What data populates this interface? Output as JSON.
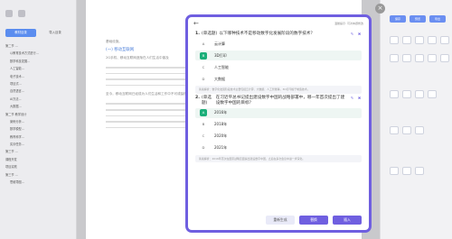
{
  "sidebar": {
    "tabs": [
      "教材目录",
      "导入目录"
    ],
    "items": [
      "第二节 ...",
      "以教育技术方式进行...",
      "数学科技发展...",
      "人工智能...",
      "电子技术...",
      "项目式...",
      "自然语言...",
      "AI方法...",
      "大数据...",
      "第二节 教学设计",
      "案例分析...",
      "数学模型...",
      "教育科学...",
      "实训任务...",
      "第三节 ...",
      "课程开发",
      "项目实践",
      "第三节 ...",
      "思维导图..."
    ]
  },
  "doc": {
    "intro": "基础设施。",
    "heading": "(一) 移动互联网",
    "paragraphs": [
      "2G手机、移动互联网逐渐在人们生活中普及",
      "至今，移动互联网已经成为人们生活和工作中不可或缺的一部分。"
    ]
  },
  "toolbar": {
    "buttons": [
      "保存",
      "预览",
      "导出"
    ]
  },
  "modal": {
    "hint": "温馨提示: 可对本题修改",
    "questions": [
      {
        "num": "1.",
        "type": "(单选题)",
        "title": "以下哪种技术不是移动数字化发展阶段的数字技术？",
        "options": [
          {
            "key": "A",
            "text": "云计算"
          },
          {
            "key": "B",
            "text": "3D打印"
          },
          {
            "key": "C",
            "text": "人工智能"
          },
          {
            "key": "D",
            "text": "大数据"
          }
        ],
        "analysis": "答案解析：数字化发展阶段技术主要包括云计算、大数据、人工智能等，3D打印属于制造技术。"
      },
      {
        "num": "2.",
        "type": "(单选题)",
        "title": "在习近平总书记提出建设数字中国的战略部署中，哪一年首次提出了建设数字中国的目标？",
        "options": [
          {
            "key": "A",
            "text": "2016年"
          },
          {
            "key": "B",
            "text": "2018年"
          },
          {
            "key": "C",
            "text": "2020年"
          },
          {
            "key": "D",
            "text": "2021年"
          }
        ],
        "analysis": "答案解析：2016年首次在国家战略层面提出建设数字中国，之后在多次会议中进一步深化。"
      }
    ],
    "buttons": {
      "regenerate": "重新生成",
      "replace": "替换",
      "insert": "插入"
    }
  },
  "colors": {
    "modal_accent": "#6f5fe0",
    "selected_option": "#1aae79",
    "toolbar_accent": "#6b8ff1"
  }
}
